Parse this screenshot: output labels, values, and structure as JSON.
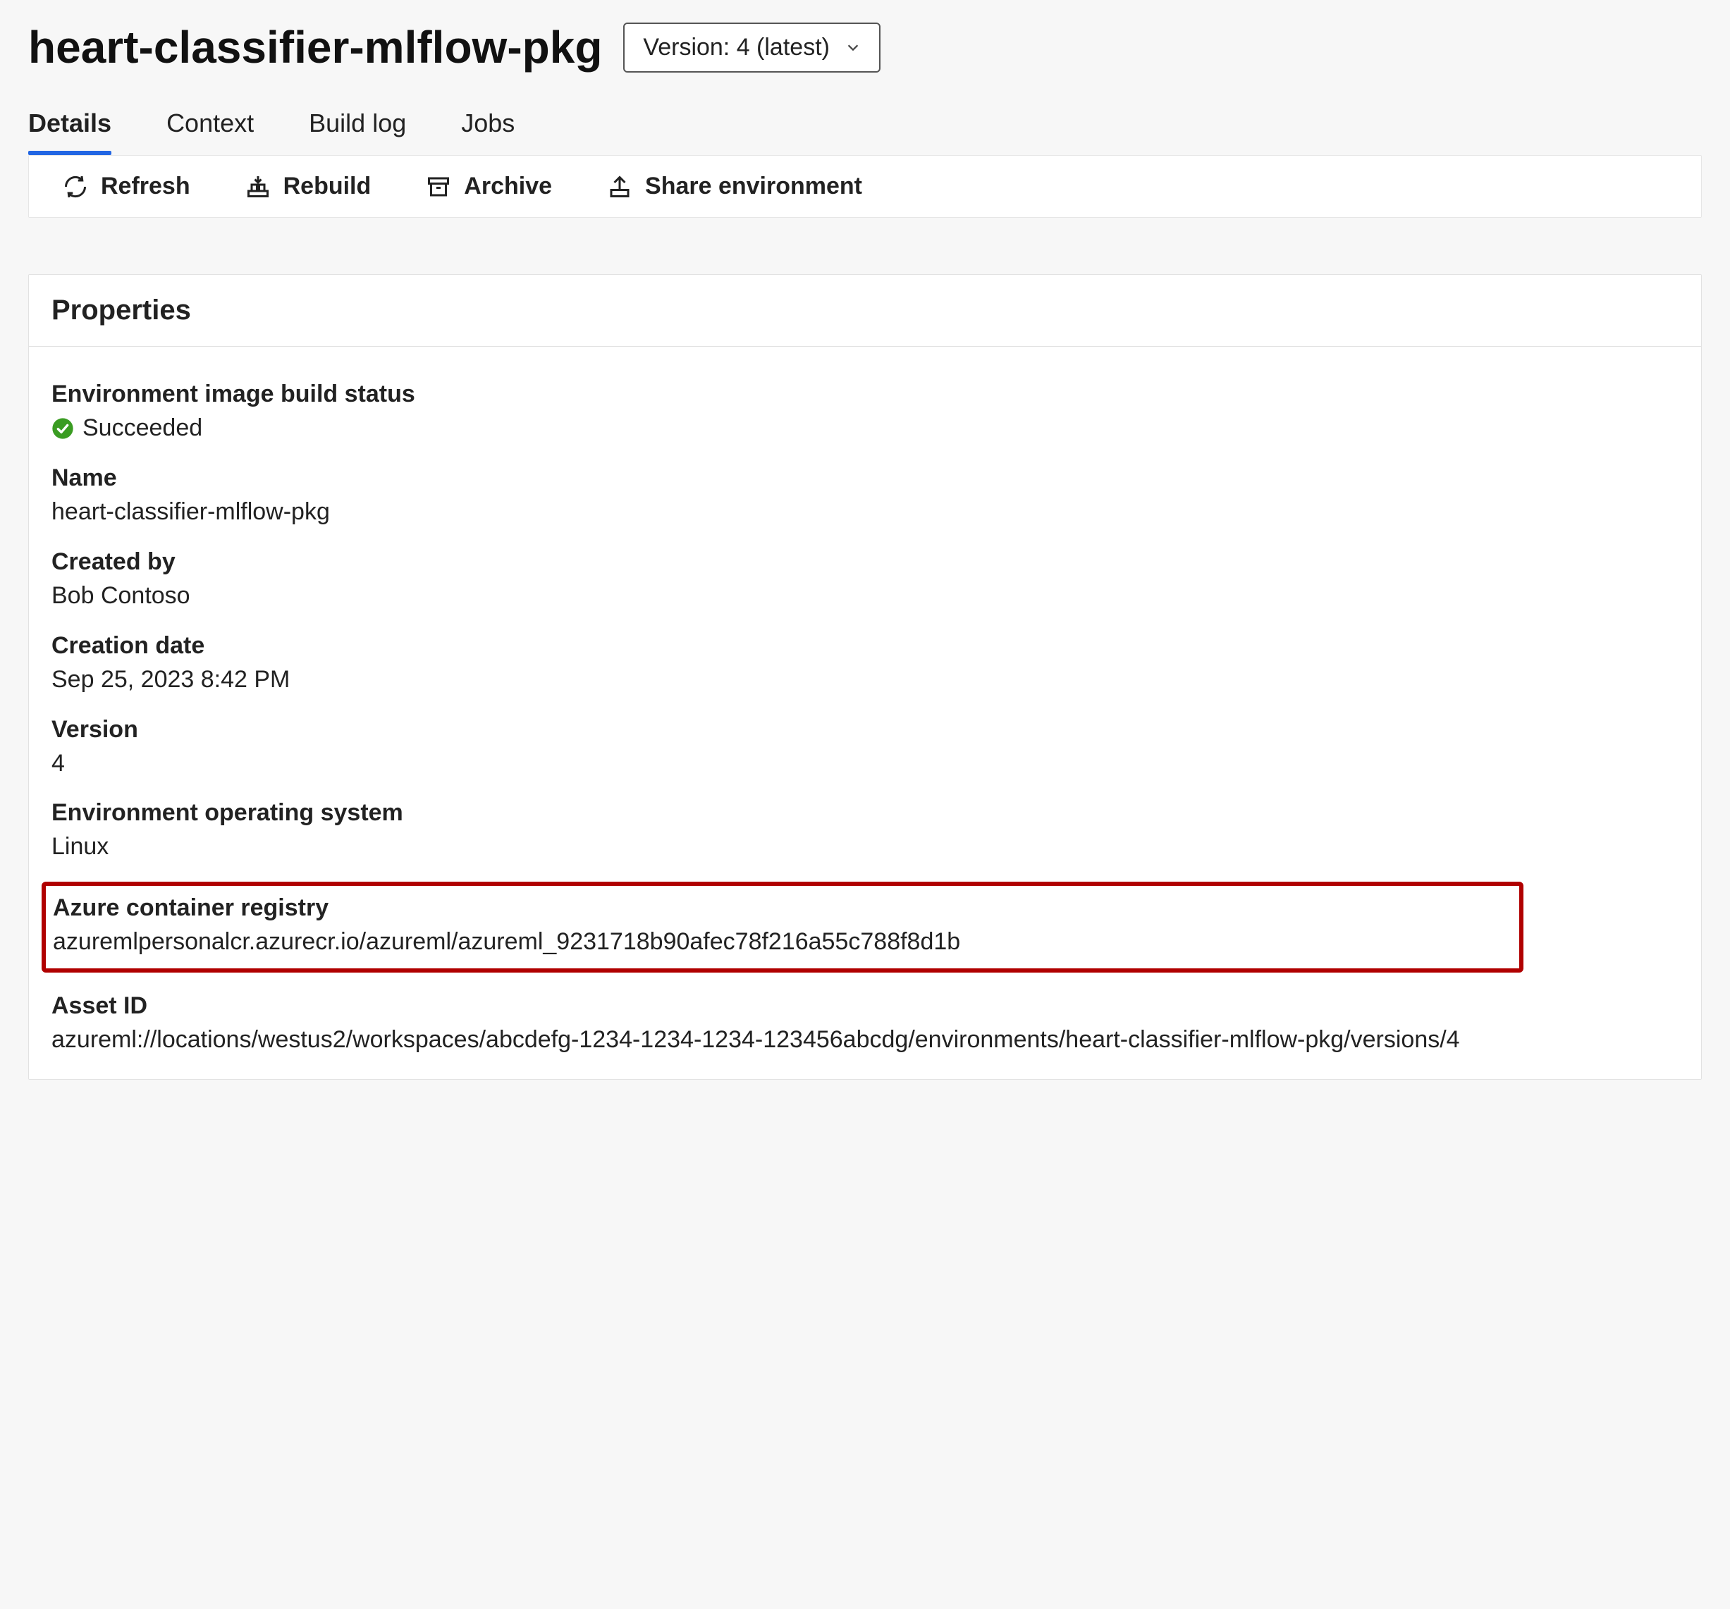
{
  "header": {
    "title": "heart-classifier-mlflow-pkg",
    "version_selector_label": "Version: 4 (latest)"
  },
  "tabs": [
    {
      "label": "Details",
      "active": true
    },
    {
      "label": "Context",
      "active": false
    },
    {
      "label": "Build log",
      "active": false
    },
    {
      "label": "Jobs",
      "active": false
    }
  ],
  "toolbar": {
    "refresh": "Refresh",
    "rebuild": "Rebuild",
    "archive": "Archive",
    "share": "Share environment"
  },
  "properties": {
    "card_title": "Properties",
    "build_status_label": "Environment image build status",
    "build_status_value": "Succeeded",
    "name_label": "Name",
    "name_value": "heart-classifier-mlflow-pkg",
    "created_by_label": "Created by",
    "created_by_value": "Bob Contoso",
    "creation_date_label": "Creation date",
    "creation_date_value": "Sep 25, 2023 8:42 PM",
    "version_label": "Version",
    "version_value": "4",
    "os_label": "Environment operating system",
    "os_value": "Linux",
    "acr_label": "Azure container registry",
    "acr_value": "azuremlpersonalcr.azurecr.io/azureml/azureml_9231718b90afec78f216a55c788f8d1b",
    "asset_id_label": "Asset ID",
    "asset_id_value": "azureml://locations/westus2/workspaces/abcdefg-1234-1234-1234-123456abcdg/environments/heart-classifier-mlflow-pkg/versions/4"
  }
}
